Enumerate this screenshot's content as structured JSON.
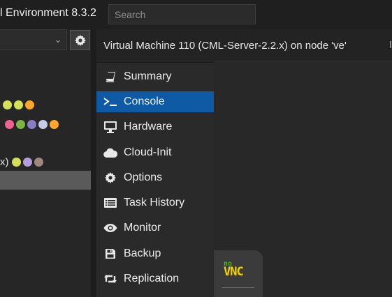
{
  "header": {
    "title": "l Environment 8.3.2",
    "search_placeholder": "Search"
  },
  "tree": {
    "rows": [
      {
        "label": "",
        "dots": [
          "#d4e157",
          "#d4e157",
          "#ffa726"
        ]
      },
      {
        "label": "",
        "dots": [
          "#f06292",
          "#7cb342",
          "#8e7cc3",
          "#c5cae9",
          "#ffa726"
        ]
      },
      {
        "label": "x)",
        "dots": [
          "#d4e157",
          "#b39ddb",
          "#a1887f"
        ]
      }
    ]
  },
  "content": {
    "title": "Virtual Machine 110 (CML-Server-2.2.x) on node 've'",
    "edge_char": "I"
  },
  "nav": {
    "items": [
      {
        "label": "Summary",
        "icon": "book-icon",
        "active": false
      },
      {
        "label": "Console",
        "icon": "terminal-icon",
        "active": true
      },
      {
        "label": "Hardware",
        "icon": "monitor-icon",
        "active": false
      },
      {
        "label": "Cloud-Init",
        "icon": "cloud-icon",
        "active": false
      },
      {
        "label": "Options",
        "icon": "gear-icon",
        "active": false
      },
      {
        "label": "Task History",
        "icon": "list-icon",
        "active": false
      },
      {
        "label": "Monitor",
        "icon": "eye-icon",
        "active": false
      },
      {
        "label": "Backup",
        "icon": "floppy-icon",
        "active": false
      },
      {
        "label": "Replication",
        "icon": "retweet-icon",
        "active": false
      }
    ]
  },
  "novnc": {
    "no": "no",
    "vnc": "VNC"
  },
  "colors": {
    "accent": "#0e5aa5",
    "background": "#1b1b1b"
  }
}
